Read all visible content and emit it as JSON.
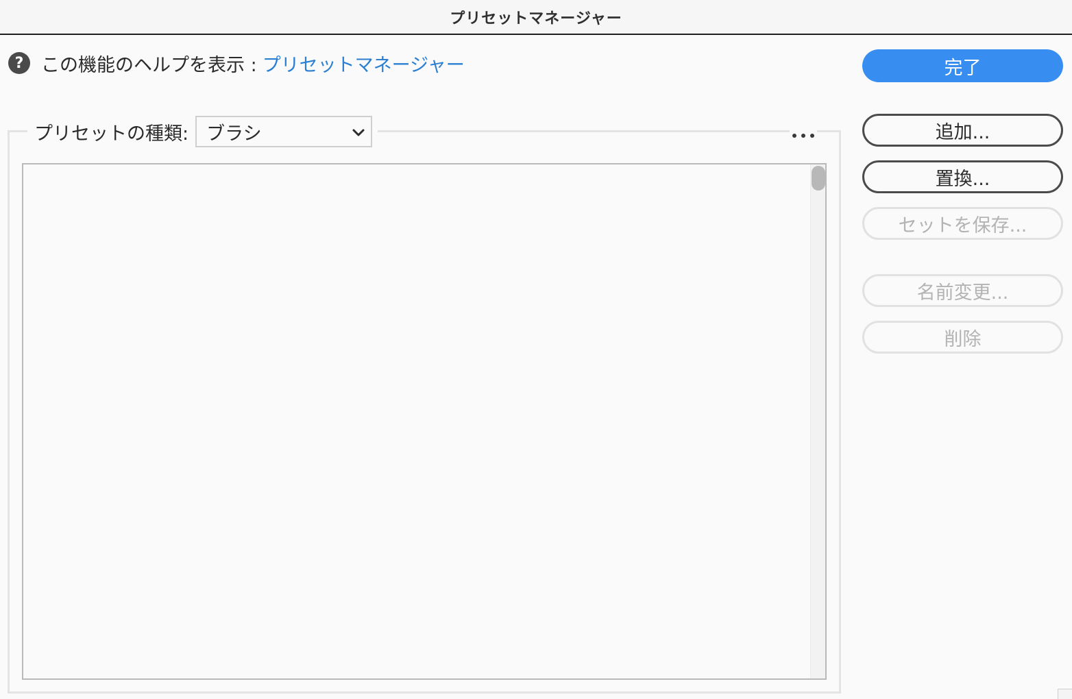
{
  "window": {
    "title": "プリセットマネージャー"
  },
  "help": {
    "icon_glyph": "?",
    "icon": "question-circle-icon",
    "text": "この機能のヘルプを表示 :",
    "link": "プリセットマネージャー",
    "link_color": "#2b7fd3"
  },
  "preset_type": {
    "label": "プリセットの種類:",
    "selected": "ブラシ"
  },
  "buttons": {
    "done": "完了",
    "add": "追加...",
    "replace": "置換...",
    "save_set": "セットを保存...",
    "rename": "名前変更...",
    "delete": "削除"
  },
  "colors": {
    "primary": "#378ef0",
    "disabled_text": "#b3b3b3"
  }
}
